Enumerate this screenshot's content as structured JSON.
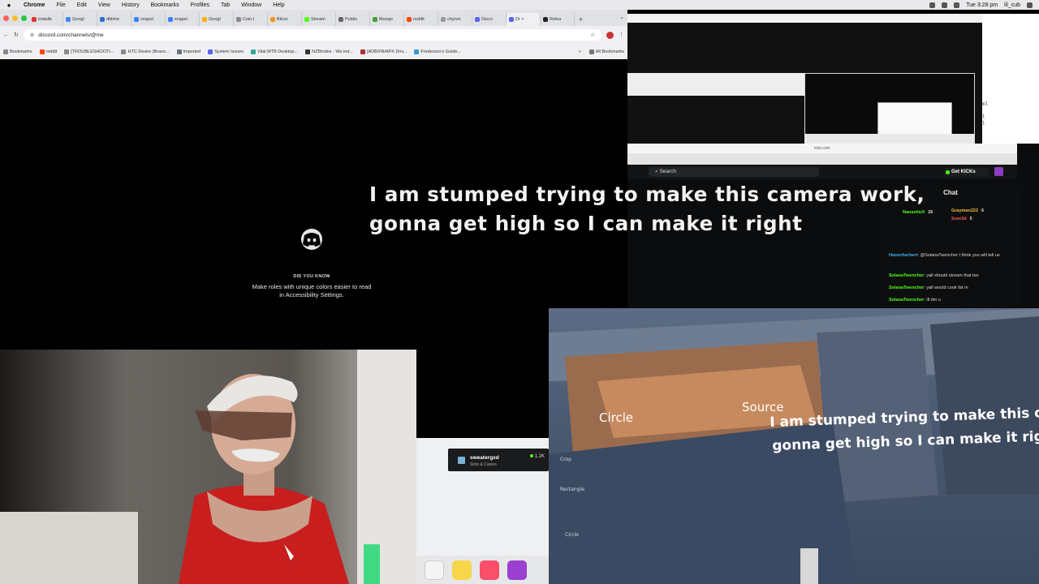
{
  "menubar": {
    "app": "Chrome",
    "items": [
      "File",
      "Edit",
      "View",
      "History",
      "Bookmarks",
      "Profiles",
      "Tab",
      "Window",
      "Help"
    ],
    "clock": "Tue 3:28 pm",
    "user": "lil_cub"
  },
  "chrome": {
    "tabs": [
      {
        "label": "installe",
        "color": "#d33"
      },
      {
        "label": "Googl",
        "color": "#4285f4"
      },
      {
        "label": "dblime",
        "color": "#2a6fd6"
      },
      {
        "label": "snapsl",
        "color": "#3b82f6"
      },
      {
        "label": "snapsl",
        "color": "#3b82f6"
      },
      {
        "label": "Googl",
        "color": "#f4b400"
      },
      {
        "label": "Coin.i",
        "color": "#888"
      },
      {
        "label": "Bitcoi",
        "color": "#f7931a"
      },
      {
        "label": "Stream",
        "color": "#53fc18"
      },
      {
        "label": "Publis",
        "color": "#666"
      },
      {
        "label": "Mongo",
        "color": "#3fa037"
      },
      {
        "label": "reddit",
        "color": "#ff4500"
      },
      {
        "label": "chyron",
        "color": "#999"
      },
      {
        "label": "Disco",
        "color": "#5865f2"
      },
      {
        "label": "Di",
        "color": "#5865f2"
      },
      {
        "label": "Relea",
        "color": "#222"
      }
    ],
    "active_tab": 14,
    "url": "discord.com/channels/@me",
    "bookmarks": [
      {
        "label": "Bookmarks",
        "color": "#888"
      },
      {
        "label": "reddit",
        "color": "#ff4500"
      },
      {
        "label": "[TROUBLESHOOTI...",
        "color": "#888"
      },
      {
        "label": "HTC Desire (Bravo...",
        "color": "#888"
      },
      {
        "label": "Imported",
        "color": "#6b7280"
      },
      {
        "label": "System Issues",
        "color": "#5865f2"
      },
      {
        "label": "Vital MTB Desktop...",
        "color": "#3a9"
      },
      {
        "label": "NZBIndex - We ind...",
        "color": "#333"
      },
      {
        "label": "[ADB/FB/APX Driv...",
        "color": "#a33"
      },
      {
        "label": "Frederuco's Guide...",
        "color": "#39c"
      }
    ],
    "all_bookmarks": "All Bookmarks"
  },
  "discord": {
    "did_you_know": "DID YOU KNOW",
    "tip_line1": "Make roles with unique colors easier to read",
    "tip_line2": "in Accessibility Settings."
  },
  "kick": {
    "url": "kick.com",
    "search_placeholder": "Search",
    "get_kicks": "Get KICKs",
    "chat_title": "Chat",
    "pinned": [
      {
        "name": "Nanashiz0",
        "count": "26",
        "color": "#53fc18"
      },
      {
        "name": "Grayman222",
        "count": "6",
        "color": "#f0c040"
      },
      {
        "name": "2see3d",
        "count": "5",
        "color": "#ff5a5a"
      }
    ],
    "messages": [
      {
        "user": "Haxenherbert",
        "text": "@SolanaTwencher I think you will tell us"
      },
      {
        "user": "SolanaTwencher",
        "text": "yall should stream that too"
      },
      {
        "user": "SolanaTwencher",
        "text": "yall would cook fat rn"
      },
      {
        "user": "SolanaTwencher",
        "text": "ill dm u"
      }
    ]
  },
  "overlay": {
    "line1": "I am stumped trying to make this camera work,",
    "line2": "gonna get high so I can make it right"
  },
  "stream_tile": {
    "name": "sweatergxd",
    "category": "Slots & Casino",
    "viewers": "1.2K"
  },
  "photo": {
    "label_circle": "Circle",
    "label_source": "Source",
    "overlay_line1": "I am stumped trying to make this camera work,",
    "overlay_line2": "gonna get high so I can make it right",
    "doc_crop": "Crop",
    "doc_rectangle": "Rectangle",
    "doc_circle": "Circle"
  }
}
